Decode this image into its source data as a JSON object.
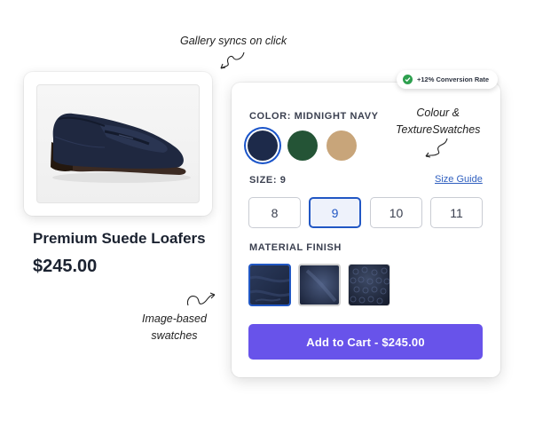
{
  "product": {
    "title": "Premium Suede Loafers",
    "price": "$245.00",
    "image": "navy-suede-loafer-photo"
  },
  "annotations": {
    "gallery": "Gallery syncs on click",
    "colour_line1": "Colour &",
    "colour_line2": "TextureSwatches",
    "image_line1": "Image-based",
    "image_line2": "swatches"
  },
  "badge": {
    "text": "+12% Conversion Rate",
    "color": "#2ea04f"
  },
  "options": {
    "color_label": "COLOR: MIDNIGHT NAVY",
    "colors": [
      {
        "name": "Midnight Navy",
        "hex": "#1d2a4a",
        "selected": true
      },
      {
        "name": "Forest Green",
        "hex": "#245436",
        "selected": false
      },
      {
        "name": "Tan",
        "hex": "#c8a57a",
        "selected": false
      }
    ],
    "size_label": "SIZE: 9",
    "size_guide": "Size Guide",
    "sizes": [
      "8",
      "9",
      "10",
      "11"
    ],
    "selected_size": "9",
    "material_label": "MATERIAL FINISH",
    "materials": [
      {
        "name": "suede",
        "selected": true
      },
      {
        "name": "velvet",
        "selected": false
      },
      {
        "name": "pebbled leather",
        "selected": false
      }
    ],
    "cta": "Add to Cart - $245.00",
    "accent": "#6853ea",
    "select_color": "#2157c4"
  }
}
